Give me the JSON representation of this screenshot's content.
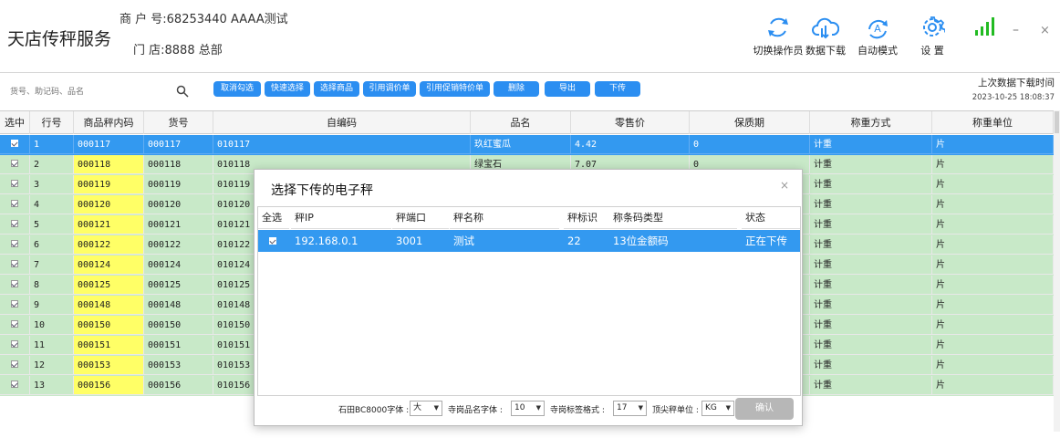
{
  "header": {
    "app_title": "天店传秤服务",
    "merchant_label": "商 户 号:",
    "merchant_value": "68253440 AAAA测试",
    "store_label": "门   店:",
    "store_value": "8888 总部",
    "buttons": [
      {
        "label": "切换操作员",
        "icon": "switch-operator-icon"
      },
      {
        "label": "数据下载",
        "icon": "cloud-download-icon"
      },
      {
        "label": "自动模式",
        "icon": "auto-mode-icon"
      },
      {
        "label": "设 置",
        "icon": "gear-icon"
      }
    ],
    "minimize": "–",
    "close": "×"
  },
  "toolbar": {
    "search_placeholder": "货号、助记码、品名",
    "buttons": [
      "取消勾选",
      "快速选择",
      "选择商品",
      "引用调价单",
      "引用促销特价单",
      "删除",
      "导出",
      "下传"
    ],
    "download_time_label": "上次数据下载时间",
    "download_time_value": "2023-10-25 18:08:37"
  },
  "table": {
    "headers": [
      "选中",
      "行号",
      "商品秤内码",
      "货号",
      "自编码",
      "品名",
      "零售价",
      "保质期",
      "称重方式",
      "称重单位"
    ],
    "rows": [
      {
        "line": "1",
        "code": "000117",
        "sku": "000117",
        "selfcode": "010117",
        "name": "玖红蜜瓜",
        "price": "4.42",
        "shelf": "0",
        "method": "计重",
        "unit": "片"
      },
      {
        "line": "2",
        "code": "000118",
        "sku": "000118",
        "selfcode": "010118",
        "name": "绿宝石",
        "price": "7.07",
        "shelf": "0",
        "method": "计重",
        "unit": "片"
      },
      {
        "line": "3",
        "code": "000119",
        "sku": "000119",
        "selfcode": "010119",
        "name": "",
        "price": "",
        "shelf": "",
        "method": "计重",
        "unit": "片"
      },
      {
        "line": "4",
        "code": "000120",
        "sku": "000120",
        "selfcode": "010120",
        "name": "",
        "price": "",
        "shelf": "",
        "method": "计重",
        "unit": "片"
      },
      {
        "line": "5",
        "code": "000121",
        "sku": "000121",
        "selfcode": "010121",
        "name": "",
        "price": "",
        "shelf": "",
        "method": "计重",
        "unit": "片"
      },
      {
        "line": "6",
        "code": "000122",
        "sku": "000122",
        "selfcode": "010122",
        "name": "",
        "price": "",
        "shelf": "",
        "method": "计重",
        "unit": "片"
      },
      {
        "line": "7",
        "code": "000124",
        "sku": "000124",
        "selfcode": "010124",
        "name": "",
        "price": "",
        "shelf": "",
        "method": "计重",
        "unit": "片"
      },
      {
        "line": "8",
        "code": "000125",
        "sku": "000125",
        "selfcode": "010125",
        "name": "",
        "price": "",
        "shelf": "",
        "method": "计重",
        "unit": "片"
      },
      {
        "line": "9",
        "code": "000148",
        "sku": "000148",
        "selfcode": "010148",
        "name": "",
        "price": "",
        "shelf": "",
        "method": "计重",
        "unit": "片"
      },
      {
        "line": "10",
        "code": "000150",
        "sku": "000150",
        "selfcode": "010150",
        "name": "",
        "price": "",
        "shelf": "",
        "method": "计重",
        "unit": "片"
      },
      {
        "line": "11",
        "code": "000151",
        "sku": "000151",
        "selfcode": "010151",
        "name": "",
        "price": "",
        "shelf": "",
        "method": "计重",
        "unit": "片"
      },
      {
        "line": "12",
        "code": "000153",
        "sku": "000153",
        "selfcode": "010153",
        "name": "",
        "price": "",
        "shelf": "",
        "method": "计重",
        "unit": "片"
      },
      {
        "line": "13",
        "code": "000156",
        "sku": "000156",
        "selfcode": "010156",
        "name": "",
        "price": "",
        "shelf": "",
        "method": "计重",
        "unit": "片"
      }
    ]
  },
  "dialog": {
    "title": "选择下传的电子秤",
    "close": "×",
    "headers": [
      "全选",
      "秤IP",
      "秤端口",
      "秤名称",
      "秤标识",
      "称条码类型",
      "状态"
    ],
    "rows": [
      {
        "ip": "192.168.0.1",
        "port": "3001",
        "name": "测试",
        "id": "22",
        "barcode_type": "13位金额码",
        "status": "正在下传"
      }
    ],
    "options": [
      {
        "label": "石田BC8000字体 :",
        "value": "大"
      },
      {
        "label": "寺岗品名字体 :",
        "value": "10"
      },
      {
        "label": "寺岗标签格式 :",
        "value": "17"
      },
      {
        "label": "顶尖秤单位 :",
        "value": "KG"
      }
    ],
    "confirm_label": "确认"
  },
  "colors": {
    "accent": "#2b8ef1",
    "selected_row": "#3399f0",
    "row_green": "#c8e9c8",
    "code_yellow": "#ffff66",
    "confirm_disabled": "#b7b7b7",
    "signal_green": "#22bb22"
  }
}
